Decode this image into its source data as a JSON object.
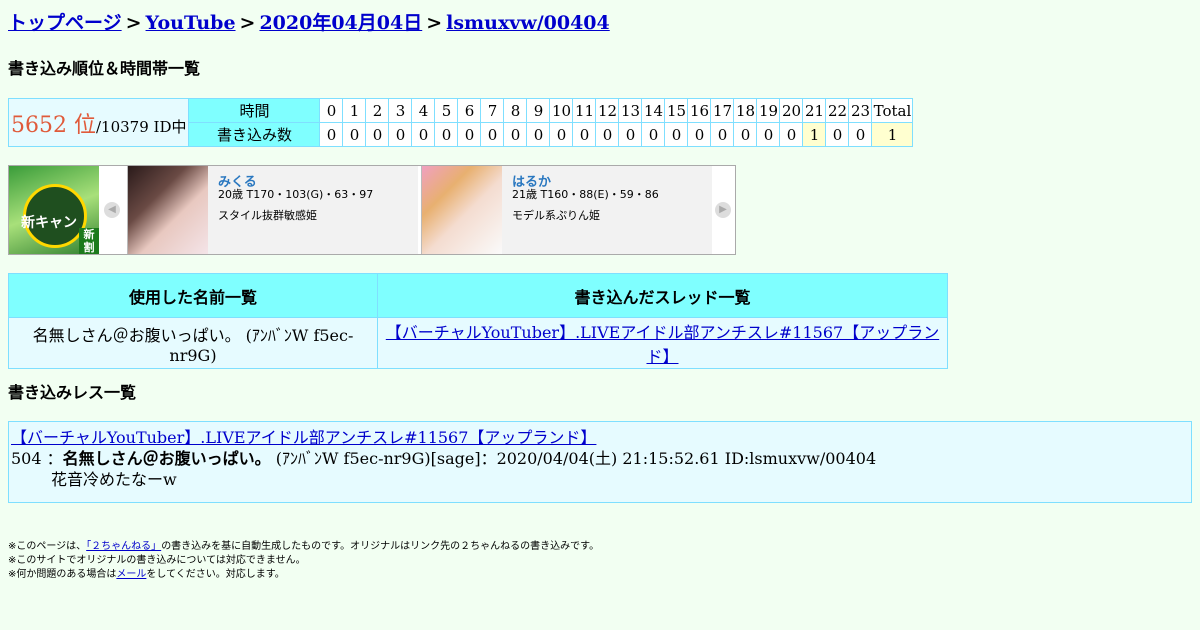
{
  "breadcrumb": {
    "top": "トップページ",
    "board": "YouTube",
    "date": "2020年04月04日",
    "id": "lsmuxvw/00404",
    "sep": ">"
  },
  "section_rank_title": "書き込み順位＆時間帯一覧",
  "rank": {
    "position": "5652 位",
    "total": "/10379 ID中",
    "row_hour_label": "時間",
    "row_count_label": "書き込み数",
    "hours": [
      "0",
      "1",
      "2",
      "3",
      "4",
      "5",
      "6",
      "7",
      "8",
      "9",
      "10",
      "11",
      "12",
      "13",
      "14",
      "15",
      "16",
      "17",
      "18",
      "19",
      "20",
      "21",
      "22",
      "23"
    ],
    "counts": [
      "0",
      "0",
      "0",
      "0",
      "0",
      "0",
      "0",
      "0",
      "0",
      "0",
      "0",
      "0",
      "0",
      "0",
      "0",
      "0",
      "0",
      "0",
      "0",
      "0",
      "0",
      "1",
      "0",
      "0"
    ],
    "total_label": "Total",
    "total_value": "1"
  },
  "ad": {
    "left_banner_text": "新キャン",
    "left_tag": "新割",
    "cards": [
      {
        "name": "みくる",
        "size": "20歳 T170・103(G)・63・97",
        "catch": "スタイル抜群敏感姫"
      },
      {
        "name": "はるか",
        "size": "21歳 T160・88(E)・59・86",
        "catch": "モデル系ぷりん姫"
      }
    ]
  },
  "names_table": {
    "col_names": "使用した名前一覧",
    "col_threads": "書き込んだスレッド一覧",
    "name": "名無しさん＠お腹いっぱい。 (ｱﾝﾊﾞﾝW f5ec-nr9G)",
    "thread": "【バーチャルYouTuber】.LIVEアイドル部アンチスレ#11567【アップランド】"
  },
  "section_res_title": "書き込みレス一覧",
  "res": {
    "thread_title": "【バーチャルYouTuber】.LIVEアイドル部アンチスレ#11567【アップランド】",
    "number": "504",
    "colon": "：",
    "name": "名無しさん＠お腹いっぱい。",
    "meta": " (ｱﾝﾊﾞﾝW f5ec-nr9G)[sage]：2020/04/04(土) 21:15:52.61 ID:lsmuxvw/00404",
    "body": "花音冷めたなーw"
  },
  "footer": {
    "line1_pre": "※このページは、",
    "line1_link": "「２ちゃんねる」",
    "line1_post": "の書き込みを基に自動生成したものです。オリジナルはリンク先の２ちゃんねるの書き込みです。",
    "line2": "※このサイトでオリジナルの書き込みについては対応できません。",
    "line3_pre": "※何か問題のある場合は",
    "line3_link": "メール",
    "line3_post": "をしてください。対応します。"
  }
}
